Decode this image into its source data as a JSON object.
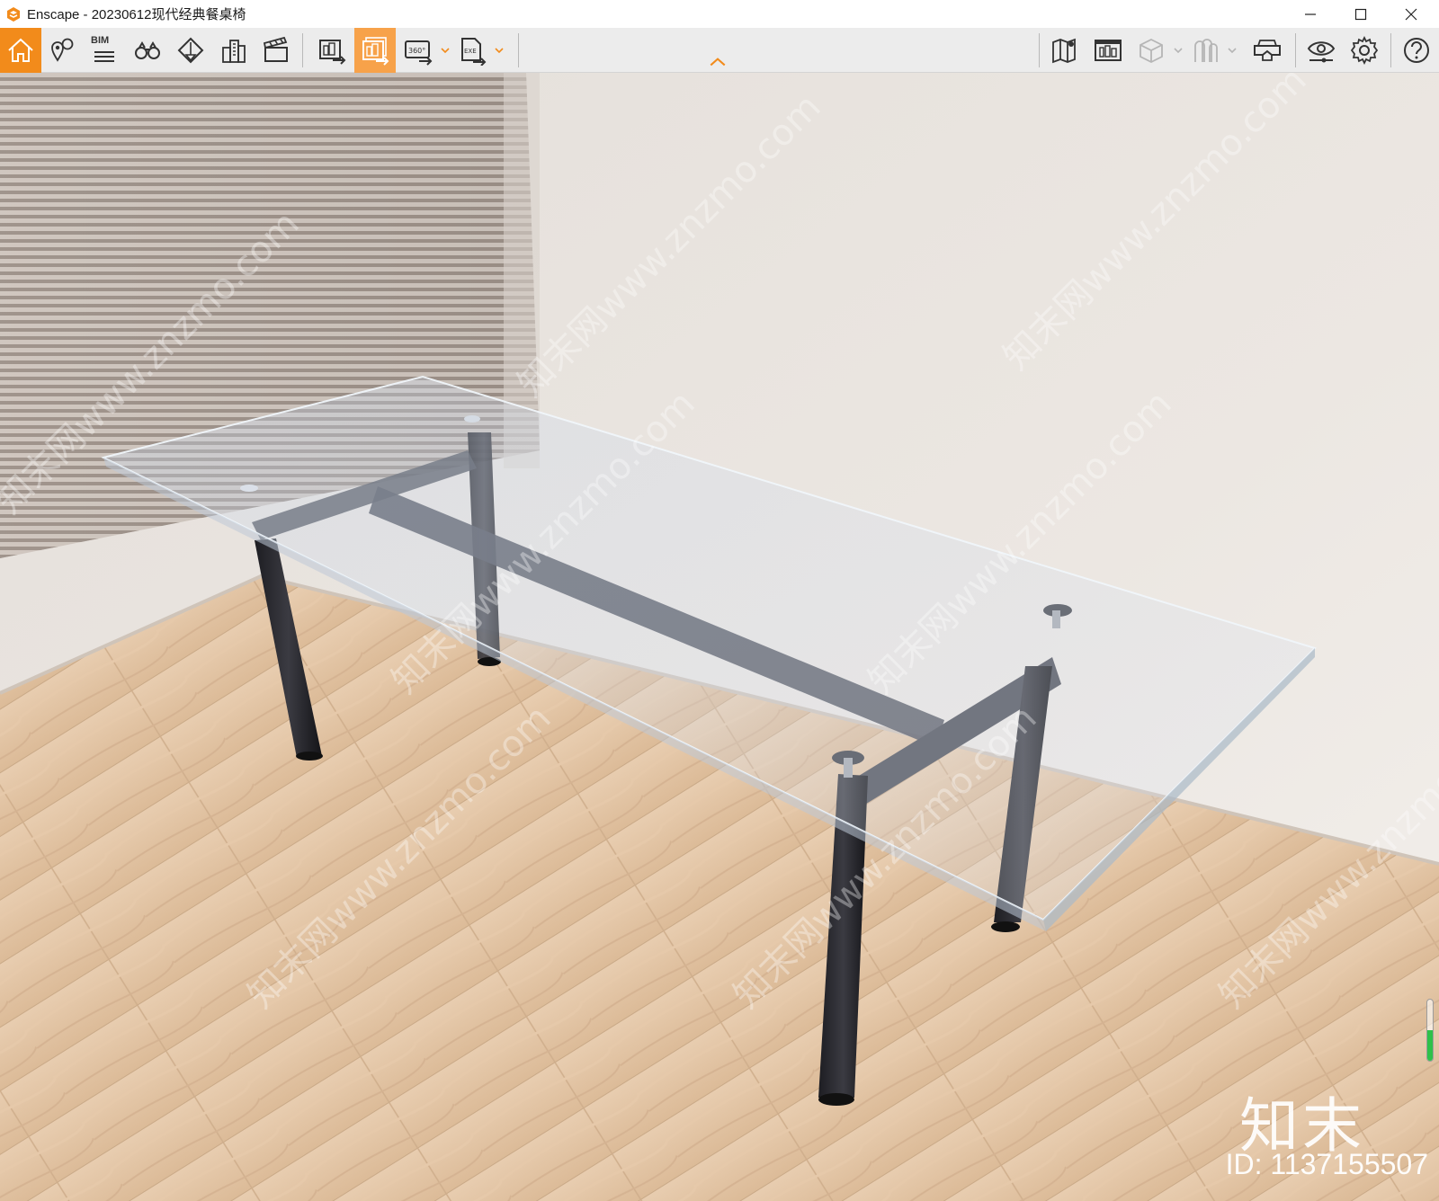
{
  "window": {
    "title": "Enscape - 20230612现代经典餐桌椅",
    "controls": [
      "minimize-icon",
      "maximize-icon",
      "close-icon"
    ]
  },
  "toolbar": {
    "left": [
      {
        "name": "home-button",
        "icon": "home-icon",
        "state": "active"
      },
      {
        "name": "views-button",
        "icon": "location-pin-icon"
      },
      {
        "name": "bim-button",
        "icon": "bim-icon",
        "label": "BIM"
      },
      {
        "name": "binoculars-button",
        "icon": "binoculars-icon"
      },
      {
        "name": "perspective-button",
        "icon": "perspective-icon"
      },
      {
        "name": "buildings-button",
        "icon": "buildings-icon"
      },
      {
        "name": "video-editor-button",
        "icon": "clapperboard-icon"
      },
      {
        "name": "screenshot-button",
        "icon": "screenshot-export-icon"
      },
      {
        "name": "batch-render-button",
        "icon": "batch-export-icon",
        "state": "highlighted"
      },
      {
        "name": "panorama-button",
        "icon": "panorama-360-icon",
        "label": "360°",
        "has_dropdown": true
      },
      {
        "name": "exe-export-button",
        "icon": "exe-export-icon",
        "label": "EXE",
        "has_dropdown": true
      }
    ],
    "right": [
      {
        "name": "map-button",
        "icon": "map-icon"
      },
      {
        "name": "asset-library-button",
        "icon": "asset-library-icon"
      },
      {
        "name": "material-cube-button",
        "icon": "cube-icon",
        "has_dropdown": true,
        "disabled": true
      },
      {
        "name": "people-button",
        "icon": "people-icon",
        "has_dropdown": true,
        "disabled": true
      },
      {
        "name": "vr-headset-button",
        "icon": "vr-headset-icon"
      },
      {
        "name": "visual-settings-button",
        "icon": "eye-icon"
      },
      {
        "name": "settings-button",
        "icon": "gear-icon"
      },
      {
        "name": "help-button",
        "icon": "help-icon"
      }
    ],
    "accent_color": "#f28b1b"
  },
  "viewport": {
    "watermark_text": "知末网www.znzmo.com",
    "logo_mark": "知末",
    "logo_id": "ID: 1137155507",
    "speed_indicator_level": 0.5
  }
}
